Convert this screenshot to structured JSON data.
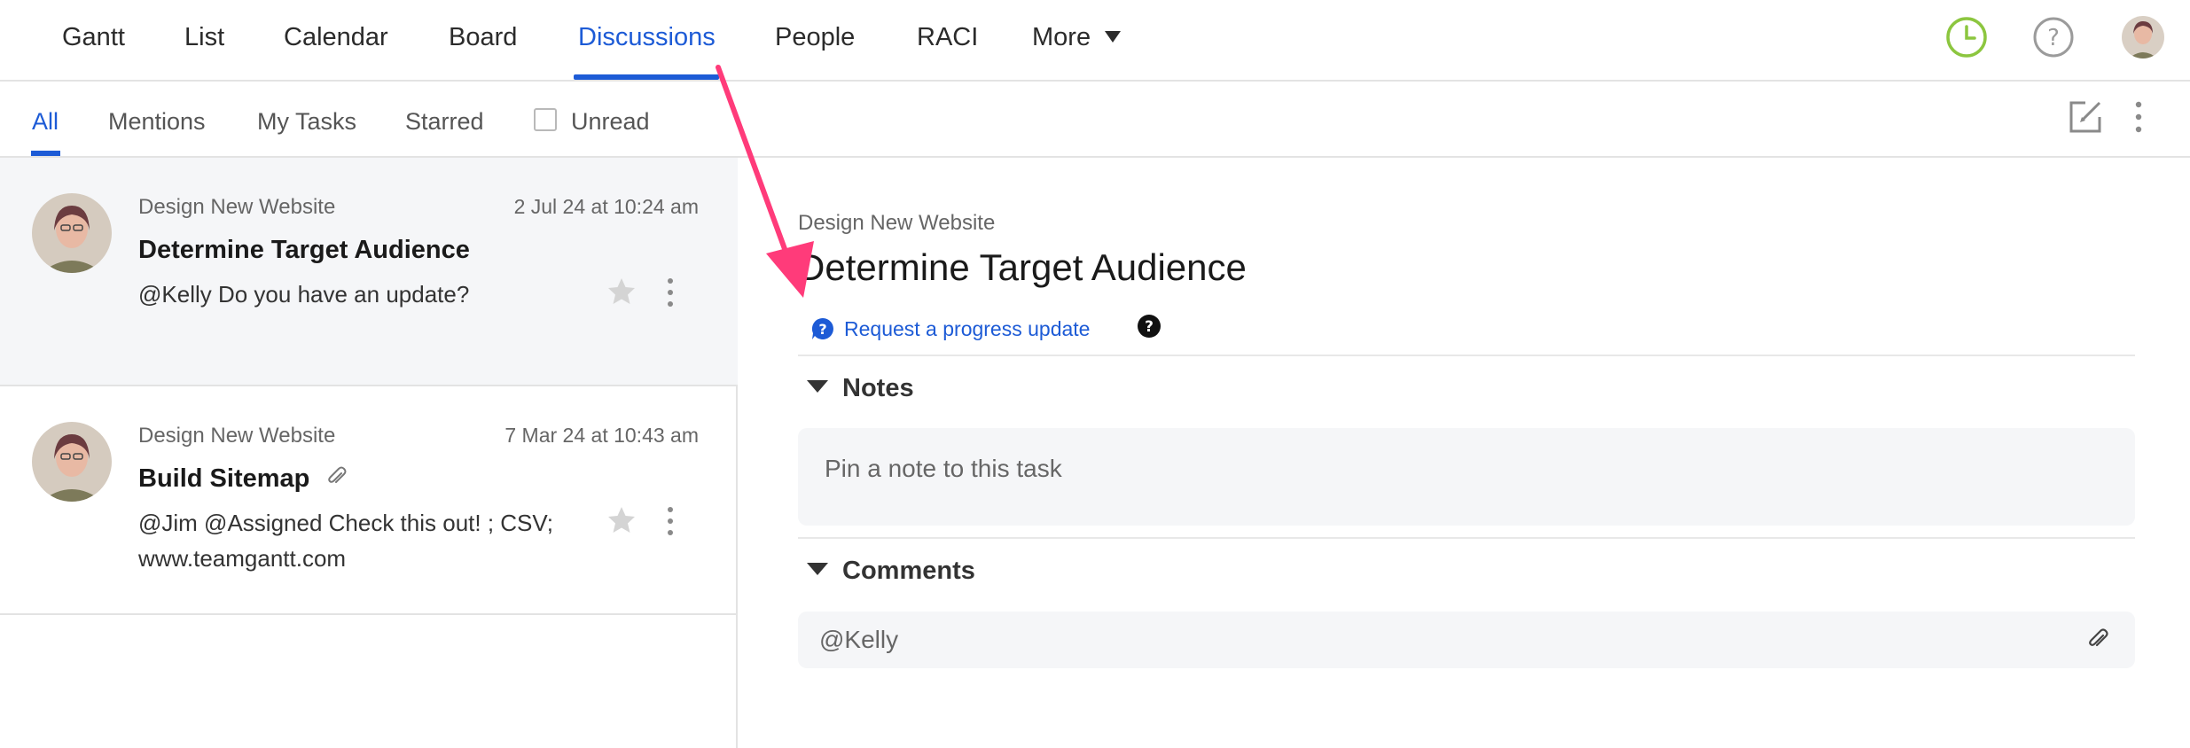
{
  "topnav": {
    "tabs": [
      {
        "label": "Gantt"
      },
      {
        "label": "List"
      },
      {
        "label": "Calendar"
      },
      {
        "label": "Board"
      },
      {
        "label": "Discussions",
        "active": true
      },
      {
        "label": "People"
      },
      {
        "label": "RACI"
      },
      {
        "label": "More"
      }
    ],
    "icons": [
      "clock-icon",
      "help-icon",
      "avatar"
    ]
  },
  "filters": {
    "tabs": [
      {
        "label": "All",
        "active": true
      },
      {
        "label": "Mentions"
      },
      {
        "label": "My Tasks"
      },
      {
        "label": "Starred"
      }
    ],
    "unread_label": "Unread",
    "unread_checked": false
  },
  "discussions": [
    {
      "project": "Design New Website",
      "date": "2 Jul 24 at 10:24 am",
      "title": "Determine Target Audience",
      "body": "@Kelly Do you have an update?",
      "selected": true,
      "attachment": false
    },
    {
      "project": "Design New Website",
      "date": "7 Mar 24 at 10:43 am",
      "title": "Build Sitemap",
      "body": "@Jim @Assigned Check this out! ; CSV; www.teamgantt.com",
      "selected": false,
      "attachment": true
    }
  ],
  "detail": {
    "project": "Design New Website",
    "title": "Determine Target Audience",
    "request_update_label": "Request a progress update",
    "notes_heading": "Notes",
    "notes_placeholder": "Pin a note to this task",
    "comments_heading": "Comments",
    "comment_value": "@Kelly"
  },
  "colors": {
    "accent": "#1d5bd6",
    "clock": "#8cc63f",
    "annotation_arrow": "#ff3b7a"
  }
}
